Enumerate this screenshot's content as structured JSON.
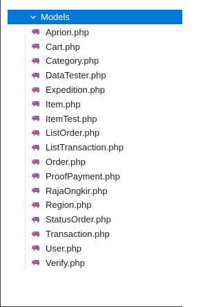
{
  "folder": {
    "label": "Models",
    "expanded": true,
    "chevron_icon": "chevron-down-icon",
    "highlight_color": "#0078d4"
  },
  "file_icon": {
    "name": "php-elephant-icon",
    "color": "#a05a8c"
  },
  "files": [
    {
      "name": "Apriori.php"
    },
    {
      "name": "Cart.php"
    },
    {
      "name": "Category.php"
    },
    {
      "name": "DataTester.php"
    },
    {
      "name": "Expedition.php"
    },
    {
      "name": "Item.php"
    },
    {
      "name": "ItemTest.php"
    },
    {
      "name": "ListOrder.php"
    },
    {
      "name": "ListTransaction.php"
    },
    {
      "name": "Order.php"
    },
    {
      "name": "ProofPayment.php"
    },
    {
      "name": "RajaOngkir.php"
    },
    {
      "name": "Region.php"
    },
    {
      "name": "StatusOrder.php"
    },
    {
      "name": "Transaction.php"
    },
    {
      "name": "User.php"
    },
    {
      "name": "Verify.php"
    }
  ]
}
